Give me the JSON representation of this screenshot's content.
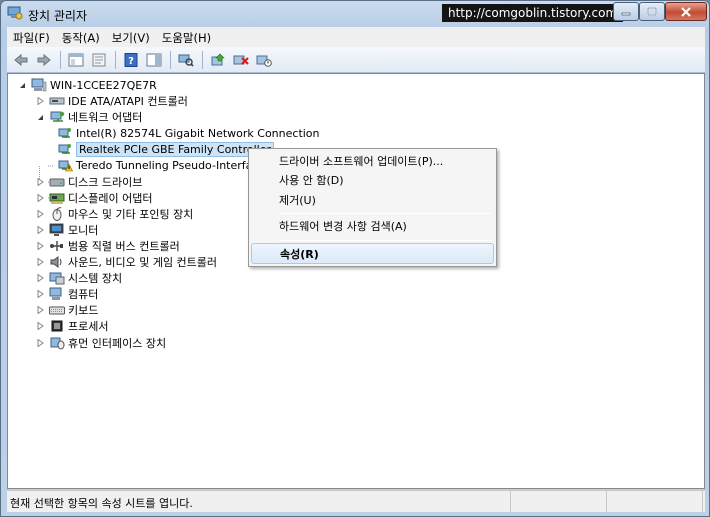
{
  "window": {
    "title": "장치 관리자",
    "watermark": "http://comgoblin.tistory.com"
  },
  "menu": [
    {
      "label": "파일(F)"
    },
    {
      "label": "동작(A)"
    },
    {
      "label": "보기(V)"
    },
    {
      "label": "도움말(H)"
    }
  ],
  "toolbar": {
    "buttons": [
      "back-arrow-icon",
      "forward-arrow-icon",
      "console-tree-icon",
      "properties-sheet-icon",
      "help-icon",
      "action-pane-icon",
      "scan-hardware-icon",
      "update-driver-icon",
      "uninstall-device-icon",
      "disable-device-icon"
    ]
  },
  "tree": {
    "root": "WIN-1CCEE27QE7R",
    "items": [
      {
        "label": "IDE ATA/ATAPI 컨트롤러",
        "level": 1,
        "expander": "collapsed",
        "icon": "ide-controller-icon"
      },
      {
        "label": "네트워크 어댑터",
        "level": 1,
        "expander": "expanded",
        "icon": "network-adapter-icon"
      },
      {
        "label": "Intel(R) 82574L Gigabit Network Connection",
        "level": 2,
        "expander": "none",
        "icon": "network-card-icon"
      },
      {
        "label": "Realtek PCIe GBE Family Controller",
        "level": 2,
        "expander": "none",
        "icon": "network-card-icon",
        "selected": true
      },
      {
        "label": "Teredo Tunneling Pseudo-Interface",
        "level": 2,
        "expander": "none",
        "icon": "network-card-warning-icon"
      },
      {
        "label": "디스크 드라이브",
        "level": 1,
        "expander": "collapsed",
        "icon": "disk-drive-icon"
      },
      {
        "label": "디스플레이 어댑터",
        "level": 1,
        "expander": "collapsed",
        "icon": "display-adapter-icon"
      },
      {
        "label": "마우스 및 기타 포인팅 장치",
        "level": 1,
        "expander": "collapsed",
        "icon": "mouse-icon"
      },
      {
        "label": "모니터",
        "level": 1,
        "expander": "collapsed",
        "icon": "monitor-icon"
      },
      {
        "label": "범용 직렬 버스 컨트롤러",
        "level": 1,
        "expander": "collapsed",
        "icon": "usb-icon"
      },
      {
        "label": "사운드, 비디오 및 게임 컨트롤러",
        "level": 1,
        "expander": "collapsed",
        "icon": "sound-icon"
      },
      {
        "label": "시스템 장치",
        "level": 1,
        "expander": "collapsed",
        "icon": "system-device-icon"
      },
      {
        "label": "컴퓨터",
        "level": 1,
        "expander": "collapsed",
        "icon": "computer-icon"
      },
      {
        "label": "키보드",
        "level": 1,
        "expander": "collapsed",
        "icon": "keyboard-icon"
      },
      {
        "label": "프로세서",
        "level": 1,
        "expander": "collapsed",
        "icon": "processor-icon"
      },
      {
        "label": "휴먼 인터페이스 장치",
        "level": 1,
        "expander": "collapsed",
        "icon": "hid-icon"
      }
    ]
  },
  "context_menu": {
    "items": [
      {
        "label": "드라이버 소프트웨어 업데이트(P)...",
        "type": "item"
      },
      {
        "label": "사용 안 함(D)",
        "type": "item"
      },
      {
        "label": "제거(U)",
        "type": "item"
      },
      {
        "type": "separator"
      },
      {
        "label": "하드웨어 변경 사항 검색(A)",
        "type": "item"
      },
      {
        "type": "separator"
      },
      {
        "label": "속성(R)",
        "type": "item",
        "highlighted": true,
        "bold": true
      }
    ]
  },
  "status": {
    "text": "현재 선택한 항목의 속성 시트를 엽니다."
  },
  "colors": {
    "selection": "#cde4f7",
    "menu_highlight": "#dbe9f9",
    "close_button": "#c44b34"
  }
}
